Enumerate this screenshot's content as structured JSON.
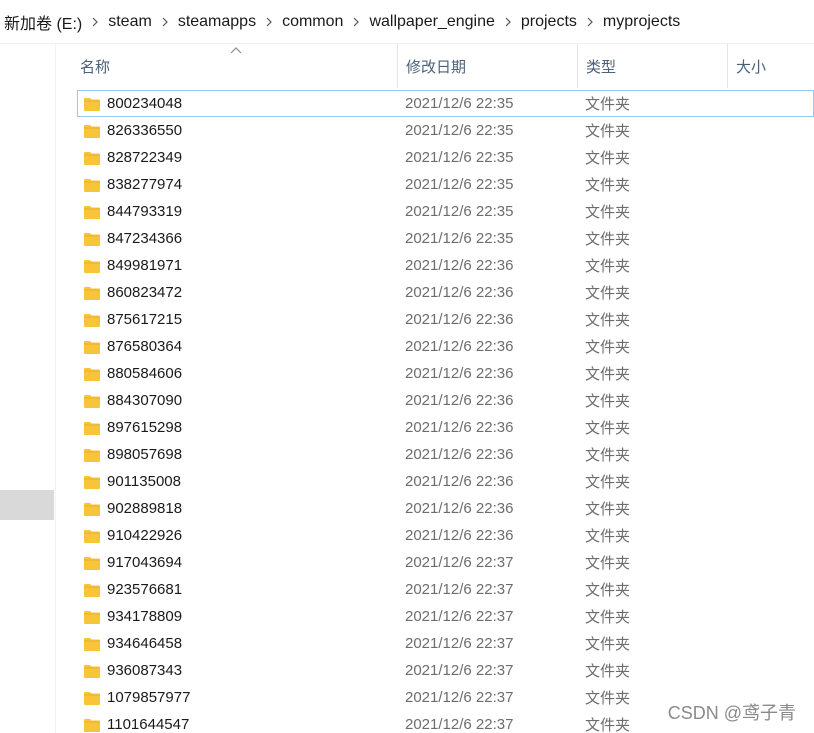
{
  "breadcrumb": [
    "新加卷 (E:)",
    "steam",
    "steamapps",
    "common",
    "wallpaper_engine",
    "projects",
    "myprojects"
  ],
  "columns": {
    "name": "名称",
    "date": "修改日期",
    "type": "类型",
    "size": "大小"
  },
  "rows": [
    {
      "name": "800234048",
      "date": "2021/12/6 22:35",
      "type": "文件夹"
    },
    {
      "name": "826336550",
      "date": "2021/12/6 22:35",
      "type": "文件夹"
    },
    {
      "name": "828722349",
      "date": "2021/12/6 22:35",
      "type": "文件夹"
    },
    {
      "name": "838277974",
      "date": "2021/12/6 22:35",
      "type": "文件夹"
    },
    {
      "name": "844793319",
      "date": "2021/12/6 22:35",
      "type": "文件夹"
    },
    {
      "name": "847234366",
      "date": "2021/12/6 22:35",
      "type": "文件夹"
    },
    {
      "name": "849981971",
      "date": "2021/12/6 22:36",
      "type": "文件夹"
    },
    {
      "name": "860823472",
      "date": "2021/12/6 22:36",
      "type": "文件夹"
    },
    {
      "name": "875617215",
      "date": "2021/12/6 22:36",
      "type": "文件夹"
    },
    {
      "name": "876580364",
      "date": "2021/12/6 22:36",
      "type": "文件夹"
    },
    {
      "name": "880584606",
      "date": "2021/12/6 22:36",
      "type": "文件夹"
    },
    {
      "name": "884307090",
      "date": "2021/12/6 22:36",
      "type": "文件夹"
    },
    {
      "name": "897615298",
      "date": "2021/12/6 22:36",
      "type": "文件夹"
    },
    {
      "name": "898057698",
      "date": "2021/12/6 22:36",
      "type": "文件夹"
    },
    {
      "name": "901135008",
      "date": "2021/12/6 22:36",
      "type": "文件夹"
    },
    {
      "name": "902889818",
      "date": "2021/12/6 22:36",
      "type": "文件夹"
    },
    {
      "name": "910422926",
      "date": "2021/12/6 22:36",
      "type": "文件夹"
    },
    {
      "name": "917043694",
      "date": "2021/12/6 22:37",
      "type": "文件夹"
    },
    {
      "name": "923576681",
      "date": "2021/12/6 22:37",
      "type": "文件夹"
    },
    {
      "name": "934178809",
      "date": "2021/12/6 22:37",
      "type": "文件夹"
    },
    {
      "name": "934646458",
      "date": "2021/12/6 22:37",
      "type": "文件夹"
    },
    {
      "name": "936087343",
      "date": "2021/12/6 22:37",
      "type": "文件夹"
    },
    {
      "name": "1079857977",
      "date": "2021/12/6 22:37",
      "type": "文件夹"
    },
    {
      "name": "1101644547",
      "date": "2021/12/6 22:37",
      "type": "文件夹"
    }
  ],
  "watermark": "CSDN @鸢子青",
  "colors": {
    "folder": "#f8c43a",
    "header_text": "#4c607a",
    "focus_border": "#99c9ef",
    "nav_selection": "#d9d9d9"
  },
  "icons": {
    "folder": "folder-icon",
    "separator": "chevron-right-icon",
    "sort": "sort-up-icon"
  }
}
